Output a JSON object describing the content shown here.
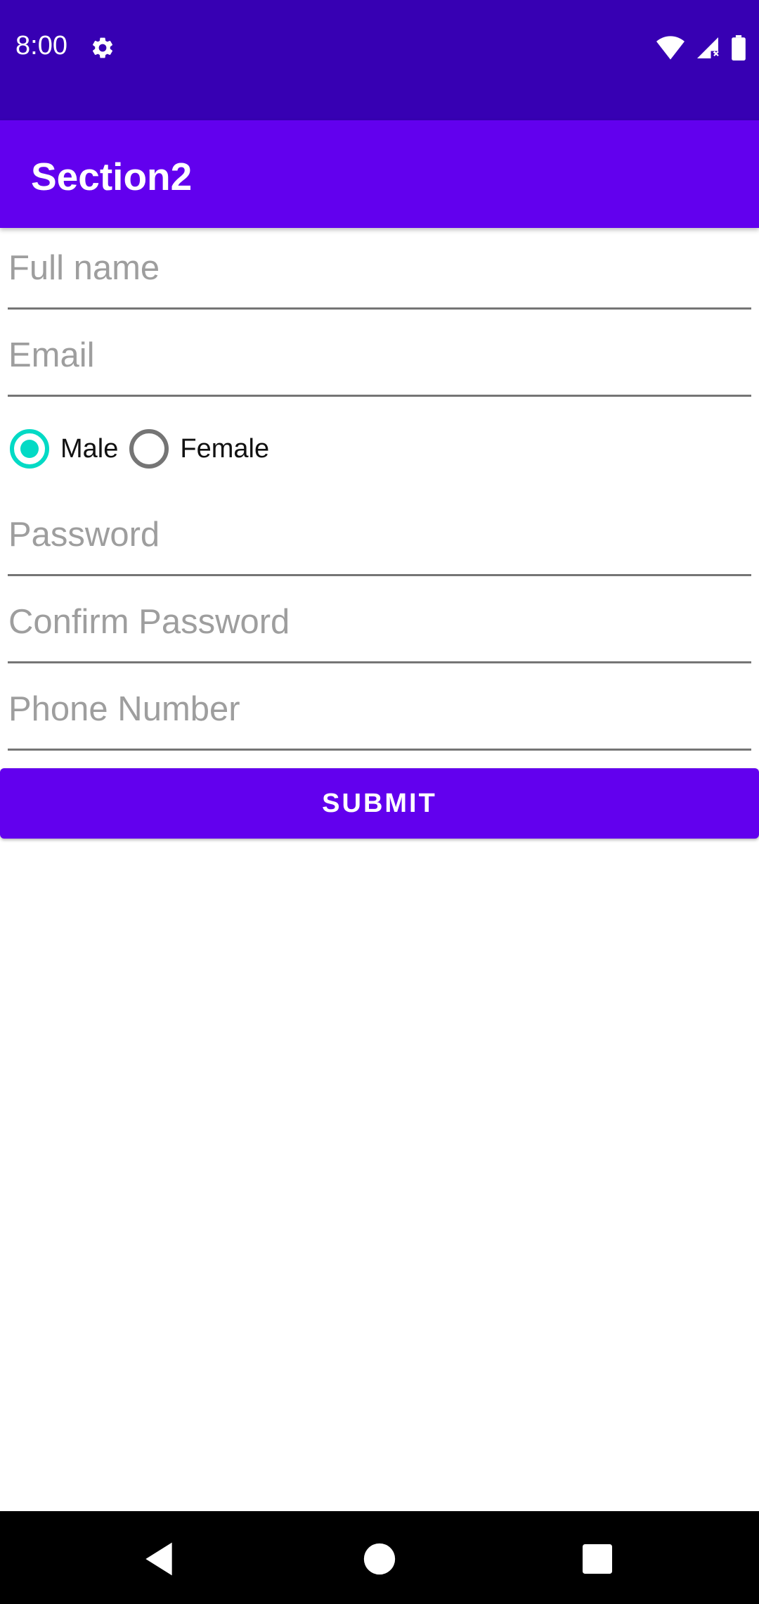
{
  "status_bar": {
    "time": "8:00",
    "icons": [
      "gear-icon",
      "wifi-icon",
      "signal-icon",
      "battery-icon"
    ],
    "background": "#3700B3"
  },
  "app_bar": {
    "title": "Section2",
    "background": "#6200EE"
  },
  "form": {
    "full_name": {
      "placeholder": "Full name",
      "value": ""
    },
    "email": {
      "placeholder": "Email",
      "value": ""
    },
    "gender": {
      "options": [
        {
          "label": "Male",
          "checked": true
        },
        {
          "label": "Female",
          "checked": false
        }
      ],
      "accent": "#03DAC5"
    },
    "password": {
      "placeholder": "Password",
      "value": ""
    },
    "confirm_password": {
      "placeholder": "Confirm Password",
      "value": ""
    },
    "phone": {
      "placeholder": "Phone Number",
      "value": ""
    },
    "submit_label": "SUBMIT"
  },
  "nav_bar": {
    "icons": [
      "back-icon",
      "home-icon",
      "recents-icon"
    ]
  }
}
